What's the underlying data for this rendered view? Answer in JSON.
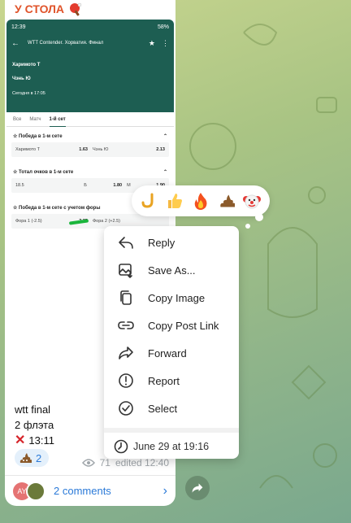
{
  "channel": {
    "title": "У СТОЛА"
  },
  "screenshot": {
    "status_time": "12:39",
    "status_battery": "58%",
    "event_title": "WTT Contender. Хорватия. Финал",
    "player1": "Харимото Т",
    "player2": "Чэнь Ю",
    "date": "Сегодня в 17:05",
    "tabs": [
      "Все",
      "Матч",
      "1-й сет"
    ],
    "markets": [
      {
        "title": "Победа в 1-м сете",
        "rows": [
          [
            {
              "label": "Харимото Т",
              "odd": "1.63"
            },
            {
              "label": "Чэнь Ю",
              "odd": "2.13"
            }
          ]
        ]
      },
      {
        "title": "Тотал очков в 1-м сете",
        "rows": [
          [
            {
              "label": "18.5",
              "odd": ""
            },
            {
              "label": "Б",
              "odd": "1.80"
            },
            {
              "label": "М",
              "odd": "1.90"
            }
          ]
        ]
      },
      {
        "title": "Победа в 1-м сете с учетом форы",
        "rows": [
          [
            {
              "label": "Фора 1 (-2.5)",
              "odd": "2.35"
            },
            {
              "label": "Фора 2 (+2.5)",
              "odd": ""
            }
          ]
        ]
      }
    ]
  },
  "post": {
    "line1": "wtt final",
    "line2": "2 флэта",
    "line3": "13:11",
    "reaction_count": "2",
    "views": "71",
    "edited": "edited 12:40",
    "avatar_initials": "AY",
    "comments": "2 comments"
  },
  "context_menu": {
    "items": [
      {
        "label": "Reply",
        "icon": "reply-icon"
      },
      {
        "label": "Save As...",
        "icon": "save-image-icon"
      },
      {
        "label": "Copy Image",
        "icon": "copy-icon"
      },
      {
        "label": "Copy Post Link",
        "icon": "link-icon"
      },
      {
        "label": "Forward",
        "icon": "forward-icon"
      },
      {
        "label": "Report",
        "icon": "report-icon"
      },
      {
        "label": "Select",
        "icon": "select-check-icon"
      }
    ],
    "date": "June 29 at 19:16"
  },
  "reactions": [
    "hook-emoji",
    "thumbs-up-emoji",
    "fire-emoji",
    "poop-emoji",
    "clown-emoji"
  ]
}
